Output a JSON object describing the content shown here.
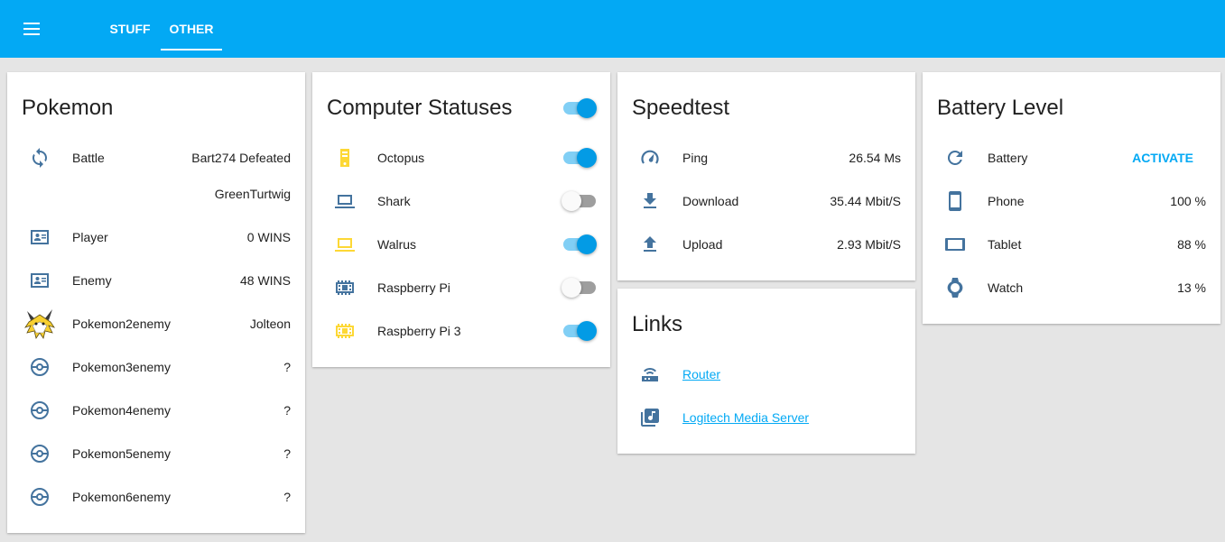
{
  "header": {
    "tabs": [
      {
        "label": "STUFF"
      },
      {
        "label": "OTHER"
      }
    ]
  },
  "pokemon": {
    "title": "Pokemon",
    "rows": [
      {
        "name": "Battle",
        "value": "Bart274 Defeated",
        "value2": "GreenTurtwig"
      },
      {
        "name": "Player",
        "value": "0 WINS"
      },
      {
        "name": "Enemy",
        "value": "48 WINS"
      },
      {
        "name": "Pokemon2enemy",
        "value": "Jolteon"
      },
      {
        "name": "Pokemon3enemy",
        "value": "?"
      },
      {
        "name": "Pokemon4enemy",
        "value": "?"
      },
      {
        "name": "Pokemon5enemy",
        "value": "?"
      },
      {
        "name": "Pokemon6enemy",
        "value": "?"
      }
    ]
  },
  "computers": {
    "title": "Computer Statuses",
    "master_toggle": "on",
    "rows": [
      {
        "name": "Octopus",
        "state": "on"
      },
      {
        "name": "Shark",
        "state": "off"
      },
      {
        "name": "Walrus",
        "state": "on"
      },
      {
        "name": "Raspberry Pi",
        "state": "off"
      },
      {
        "name": "Raspberry Pi 3",
        "state": "on"
      }
    ]
  },
  "speedtest": {
    "title": "Speedtest",
    "rows": [
      {
        "name": "Ping",
        "value": "26.54 Ms"
      },
      {
        "name": "Download",
        "value": "35.44 Mbit/S"
      },
      {
        "name": "Upload",
        "value": "2.93 Mbit/S"
      }
    ]
  },
  "links": {
    "title": "Links",
    "rows": [
      {
        "name": "Router"
      },
      {
        "name": "Logitech Media Server"
      }
    ]
  },
  "battery": {
    "title": "Battery Level",
    "rows": [
      {
        "name": "Battery",
        "action": "ACTIVATE"
      },
      {
        "name": "Phone",
        "value": "100 %"
      },
      {
        "name": "Tablet",
        "value": "88 %"
      },
      {
        "name": "Watch",
        "value": "13 %"
      }
    ]
  },
  "colors": {
    "accent": "#03a9f4",
    "icon_blue": "#44739e",
    "icon_yellow": "#fdd835",
    "background": "#e5e5e5"
  }
}
